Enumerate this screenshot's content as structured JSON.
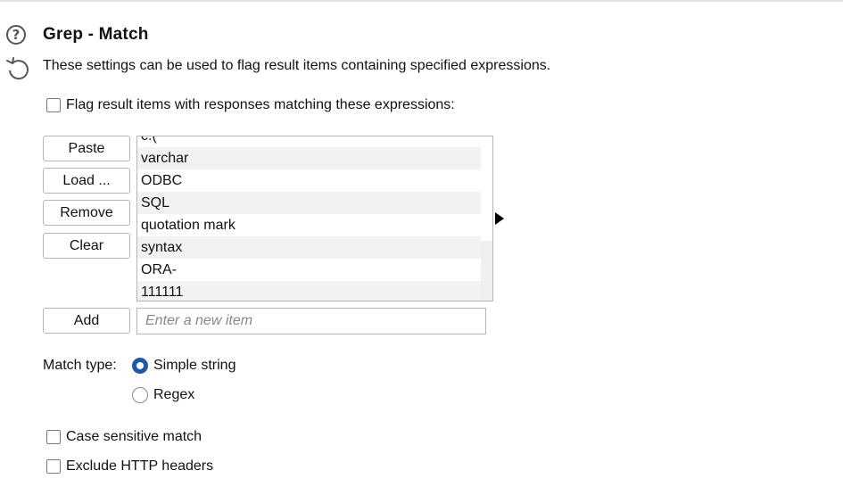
{
  "header": {
    "title": "Grep - Match",
    "description": "These settings can be used to flag result items containing specified expressions."
  },
  "flag_checkbox": {
    "label": "Flag result items with responses matching these expressions:",
    "checked": false
  },
  "buttons": {
    "paste": "Paste",
    "load": "Load ...",
    "remove": "Remove",
    "clear": "Clear",
    "add": "Add"
  },
  "list": {
    "partial_top": "c.(",
    "items": [
      "varchar",
      "ODBC",
      "SQL",
      "quotation mark",
      "syntax",
      "ORA-",
      "111111"
    ]
  },
  "new_item": {
    "placeholder": "Enter a new item",
    "value": ""
  },
  "match_type": {
    "label": "Match type:",
    "options": [
      {
        "label": "Simple string",
        "selected": true
      },
      {
        "label": "Regex",
        "selected": false
      }
    ]
  },
  "options": {
    "case_sensitive": {
      "label": "Case sensitive match",
      "checked": false
    },
    "exclude_headers": {
      "label": "Exclude HTTP headers",
      "checked": false
    }
  },
  "colors": {
    "accent": "#1e5aa8",
    "row_alt": "#f2f2f2",
    "border": "#b5b5b5"
  }
}
